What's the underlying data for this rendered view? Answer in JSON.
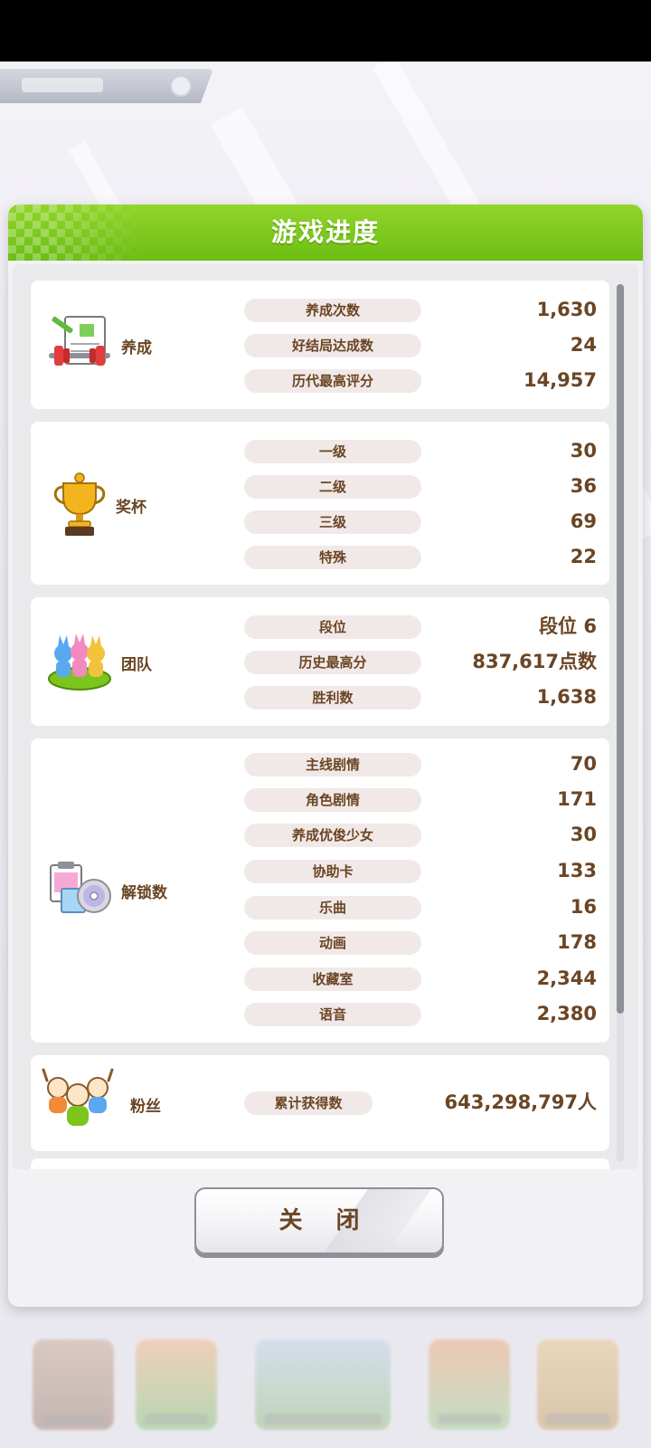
{
  "dialog": {
    "title": "游戏进度",
    "close_label": "关 闭"
  },
  "colors": {
    "header_green": "#7cc51c",
    "text_brown": "#6b4524",
    "pill_bg": "#f1e9e8"
  },
  "sections": {
    "training": {
      "label": "养成",
      "icon": "training-notebook-dumbbell-icon",
      "rows": [
        {
          "label": "养成次数",
          "value": "1,630"
        },
        {
          "label": "好结局达成数",
          "value": "24"
        },
        {
          "label": "历代最高评分",
          "value": "14,957"
        }
      ]
    },
    "trophy": {
      "label": "奖杯",
      "icon": "trophy-icon",
      "rows": [
        {
          "label": "一级",
          "value": "30"
        },
        {
          "label": "二级",
          "value": "36"
        },
        {
          "label": "三级",
          "value": "69"
        },
        {
          "label": "特殊",
          "value": "22"
        }
      ]
    },
    "team": {
      "label": "团队",
      "icon": "team-figures-icon",
      "rows": [
        {
          "label": "段位",
          "value": "段位 6"
        },
        {
          "label": "历史最高分",
          "value": "837,617点数"
        },
        {
          "label": "胜利数",
          "value": "1,638"
        }
      ]
    },
    "unlocks": {
      "label": "解锁数",
      "icon": "unlock-cards-disc-icon",
      "rows": [
        {
          "label": "主线剧情",
          "value": "70"
        },
        {
          "label": "角色剧情",
          "value": "171"
        },
        {
          "label": "养成优俊少女",
          "value": "30"
        },
        {
          "label": "协助卡",
          "value": "133"
        },
        {
          "label": "乐曲",
          "value": "16"
        },
        {
          "label": "动画",
          "value": "178"
        },
        {
          "label": "收藏室",
          "value": "2,344"
        },
        {
          "label": "语音",
          "value": "2,380"
        }
      ]
    },
    "fans": {
      "label": "粉丝",
      "icon": "fans-crowd-icon",
      "rows": [
        {
          "label": "累计获得数",
          "value": "643,298,797人"
        }
      ]
    }
  }
}
